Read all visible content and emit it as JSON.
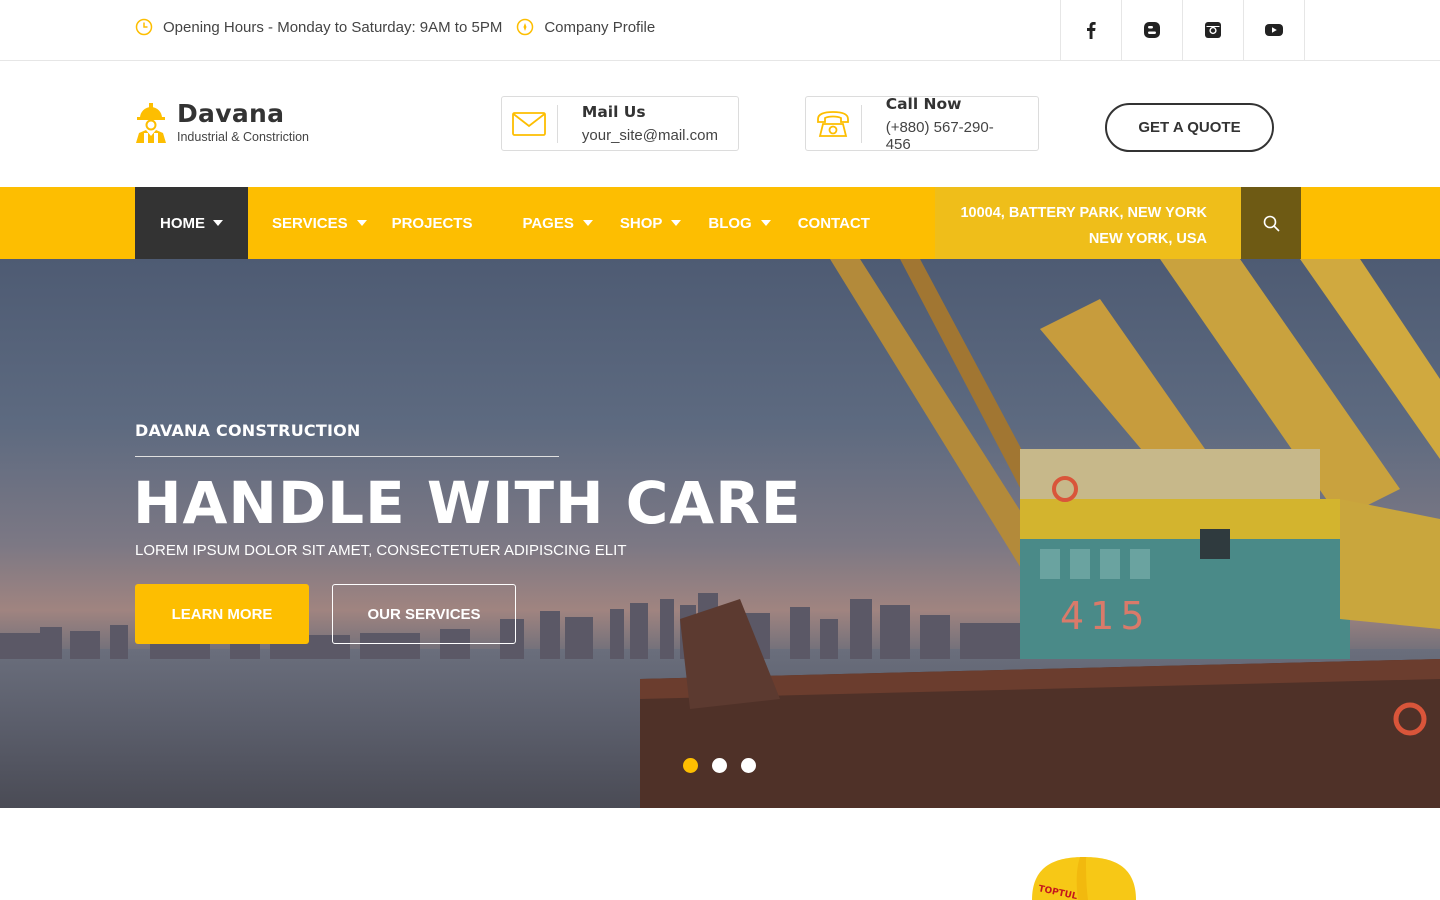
{
  "topbar": {
    "hours": "Opening Hours - Monday to Saturday: 9AM to 5PM",
    "profile": "Company Profile",
    "socials": [
      {
        "icon": "facebook-icon"
      },
      {
        "icon": "blogger-icon"
      },
      {
        "icon": "instagram-icon"
      },
      {
        "icon": "youtube-icon"
      }
    ]
  },
  "header": {
    "brand": "Davana",
    "tagline": "Industrial & Constriction",
    "mail": {
      "title": "Mail Us",
      "value": "your_site@mail.com",
      "icon": "envelope-icon"
    },
    "call": {
      "title": "Call Now",
      "value": "(+880) 567-290-456",
      "icon": "telephone-icon"
    },
    "quote_label": "GET A QUOTE"
  },
  "nav": {
    "items": [
      {
        "label": "HOME",
        "dropdown": true,
        "active": true
      },
      {
        "label": "SERVICES",
        "dropdown": true
      },
      {
        "label": "PROJECTS",
        "dropdown": false
      },
      {
        "label": "PAGES",
        "dropdown": true
      },
      {
        "label": "SHOP",
        "dropdown": true
      },
      {
        "label": "BLOG",
        "dropdown": true
      },
      {
        "label": "CONTACT",
        "dropdown": false
      }
    ],
    "address_line1": "10004, BATTERY PARK, NEW YORK",
    "address_line2": "NEW YORK, USA",
    "search_icon": "search-icon"
  },
  "hero": {
    "eyebrow": "DAVANA CONSTRUCTION",
    "headline": "HANDLE WITH CARE",
    "subtitle": "LOREM IPSUM DOLOR SIT AMET, CONSECTETUER ADIPISCING ELIT",
    "learn_more": "LEARN MORE",
    "our_services": "OUR SERVICES",
    "slides": 3,
    "active_slide": 1
  },
  "colors": {
    "accent": "#fdbe01",
    "dark": "#333333",
    "address_bg": "#efbe1a",
    "search_bg": "#6e5a14"
  }
}
